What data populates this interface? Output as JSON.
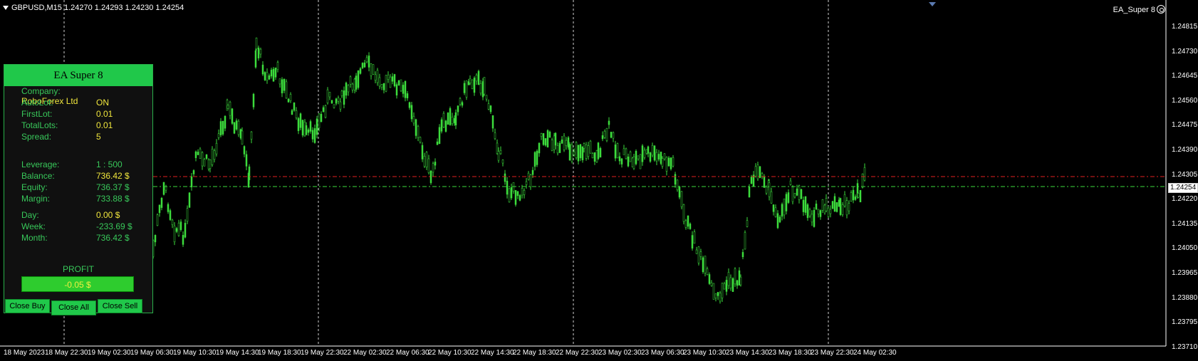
{
  "chart": {
    "symbol_line": "GBPUSD,M15  1.24270 1.24293 1.24230 1.24254",
    "ea_name": "EA_Super 8",
    "current_price": "1.24254",
    "y_ticks": [
      "1.24815",
      "1.24730",
      "1.24645",
      "1.24560",
      "1.24475",
      "1.24390",
      "1.24305",
      "1.24220",
      "1.24135",
      "1.24050",
      "1.23965",
      "1.23880",
      "1.23795",
      "1.23710"
    ],
    "x_ticks": [
      "18 May 2023",
      "18 May 22:30",
      "19 May 02:30",
      "19 May 06:30",
      "19 May 10:30",
      "19 May 14:30",
      "19 May 18:30",
      "19 May 22:30",
      "22 May 02:30",
      "22 May 06:30",
      "22 May 10:30",
      "22 May 14:30",
      "22 May 18:30",
      "22 May 22:30",
      "23 May 02:30",
      "23 May 06:30",
      "23 May 10:30",
      "23 May 14:30",
      "23 May 18:30",
      "23 May 22:30",
      "24 May 02:30"
    ],
    "colors": {
      "candle": "#3cdc3c",
      "red_line": "#e02020",
      "green_line": "#3cdc3c",
      "grid": "#cfcfcf"
    }
  },
  "panel": {
    "title": "EA Super 8",
    "rows": [
      {
        "k": "Company:",
        "v": "RoboForex Ltd",
        "c": "yellow"
      },
      {
        "k": "AutoLot:",
        "v": "ON",
        "c": "yellow"
      },
      {
        "k": "FirstLot:",
        "v": "0.01",
        "c": "yellow"
      },
      {
        "k": "TotalLots:",
        "v": "0.01",
        "c": "yellow"
      },
      {
        "k": "Spread:",
        "v": "5",
        "c": "yellow"
      },
      {
        "k": "Leverage:",
        "v": "1 : 500",
        "c": "green"
      },
      {
        "k": "Balance:",
        "v": "736.42 $",
        "c": "yellow"
      },
      {
        "k": "Equity:",
        "v": "736.37 $",
        "c": "green"
      },
      {
        "k": "Margin:",
        "v": "733.88 $",
        "c": "green"
      },
      {
        "k": "Day:",
        "v": "0.00 $",
        "c": "yellow"
      },
      {
        "k": "Week:",
        "v": "-233.69 $",
        "c": "green"
      },
      {
        "k": "Month:",
        "v": "736.42 $",
        "c": "green"
      }
    ],
    "profit_label": "PROFIT",
    "profit_value": "-0.05 $",
    "buttons": {
      "close_buy": "Close Buy",
      "close_all": "Close All",
      "close_sell": "Close Sell"
    }
  }
}
